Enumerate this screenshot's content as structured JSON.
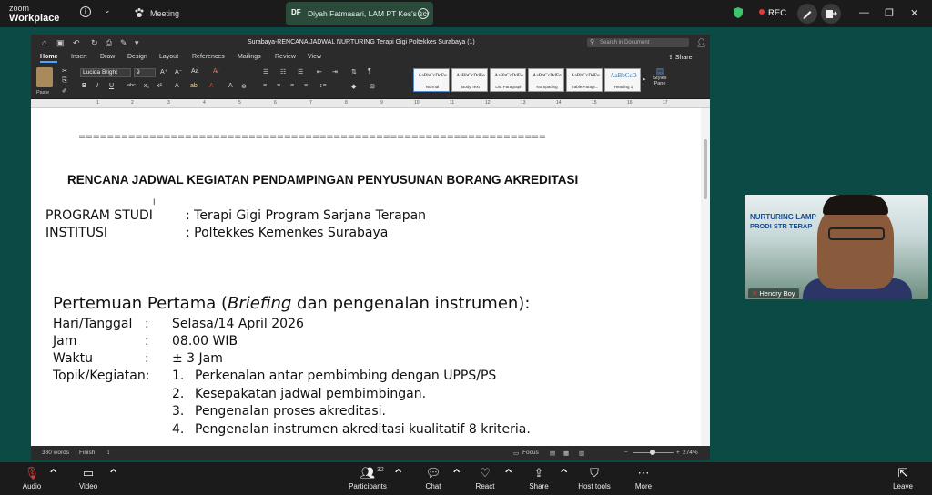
{
  "zoom": {
    "logo_small": "zoom",
    "logo_big": "Workplace",
    "meeting_label": "Meeting",
    "share_avatar": "DF",
    "share_title": "Diyah Fatmasari, LAM PT Kes's scr",
    "rec_label": "REC"
  },
  "word": {
    "doc_title": "Surabaya-RENCANA JADWAL NURTURING Terapi Gigi Poltekkes Surabaya (1)",
    "search_placeholder": "Search in Document",
    "tabs": [
      "Home",
      "Insert",
      "Draw",
      "Design",
      "Layout",
      "References",
      "Mailings",
      "Review",
      "View"
    ],
    "share_label": "Share",
    "paste_label": "Paste",
    "font_name": "Lucida Bright",
    "font_size": "9",
    "styles": [
      {
        "preview": "AaBbCcDdEe",
        "name": "Normal"
      },
      {
        "preview": "AaBbCcDdEe",
        "name": "Body Text"
      },
      {
        "preview": "AaBbCcDdEe",
        "name": "List Paragraph"
      },
      {
        "preview": "AaBbCcDdEe",
        "name": "No Spacing"
      },
      {
        "preview": "AaBbCcDdEe",
        "name": "Table Paragr..."
      },
      {
        "preview": "AaBbCcD",
        "name": "Heading 1"
      }
    ],
    "styles_pane": "Styles Pane",
    "ruler_numbers": [
      "1",
      "2",
      "3",
      "4",
      "5",
      "6",
      "7",
      "8",
      "9",
      "10",
      "11",
      "12",
      "13",
      "14",
      "15",
      "16",
      "17"
    ],
    "status": {
      "words": "380 words",
      "finish": "Finish",
      "focus": "Focus",
      "zoom": "274%"
    }
  },
  "document": {
    "separator": "==================================================================",
    "title": "RENCANA JADWAL KEGIATAN PENDAMPINGAN PENYUSUNAN BORANG AKREDITASI",
    "program_label": "PROGRAM STUDI",
    "program_value": ": Terapi Gigi Program Sarjana Terapan",
    "institusi_label": "INSTITUSI",
    "institusi_value": ": Poltekkes Kemenkes Surabaya",
    "section_pre": "Pertemuan Pertama (",
    "section_em": "Briefing",
    "section_post": " dan pengenalan instrumen):",
    "rows": [
      {
        "label": "Hari/Tanggal",
        "sep": ":",
        "value": "Selasa/14  April 2026"
      },
      {
        "label": "Jam",
        "sep": ":",
        "value": "08.00 WIB"
      },
      {
        "label": "Waktu",
        "sep": ":",
        "value": "± 3 Jam"
      },
      {
        "label": "Topik/Kegiatan:",
        "sep": "",
        "value": ""
      }
    ],
    "topics": [
      {
        "num": "1.",
        "text": "Perkenalan antar pembimbing dengan UPPS/PS"
      },
      {
        "num": "2.",
        "text": "Kesepakatan jadwal pembimbingan."
      },
      {
        "num": "3.",
        "text": "Pengenalan proses akreditasi."
      },
      {
        "num": "4.",
        "text": "Pengenalan instrumen akreditasi kualitatif 8 kriteria."
      }
    ]
  },
  "video": {
    "participant_name": "Hendry Boy",
    "banner_line1": "NURTURING LAMP",
    "banner_line2": "PRODI STR TERAP"
  },
  "toolbar": {
    "audio": "Audio",
    "video": "Video",
    "participants": "Participants",
    "participants_count": "32",
    "chat": "Chat",
    "react": "React",
    "share": "Share",
    "host_tools": "Host tools",
    "more": "More",
    "leave": "Leave"
  }
}
